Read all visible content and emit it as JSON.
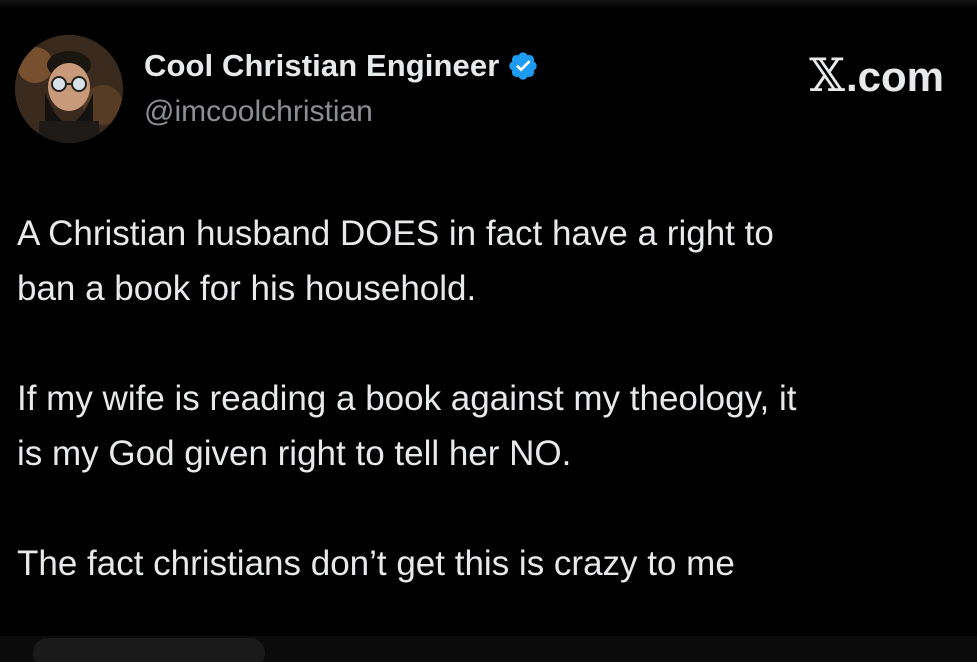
{
  "tweet": {
    "author": {
      "display_name": "Cool Christian Engineer",
      "handle": "@imcoolchristian",
      "verified": true,
      "verified_icon": "verified-badge-icon",
      "verified_color": "#1d9bf0"
    },
    "brand": {
      "x_glyph": "𝕏",
      "suffix": ".com"
    },
    "paragraphs": [
      "A Christian husband DOES in fact have a right to\nban a book for his household.",
      "If my wife is reading a book against my theology, it\nis my God given right to tell her NO.",
      "The fact christians don’t get this is crazy to me"
    ]
  },
  "colors": {
    "background": "#000000",
    "text_primary": "#e7e9ea",
    "text_secondary": "#8b8f94"
  }
}
